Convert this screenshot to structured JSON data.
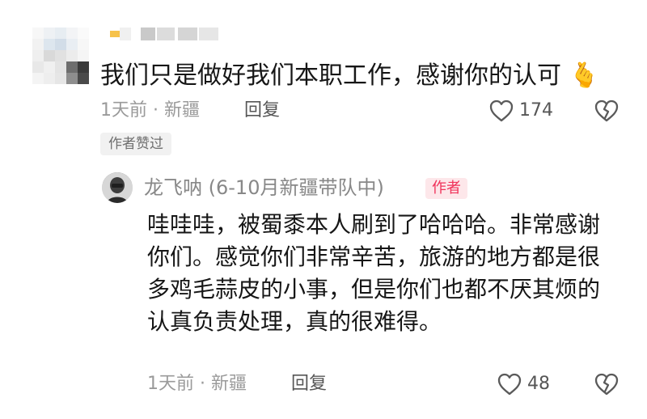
{
  "comment": {
    "text": "我们只是做好我们本职工作，感谢你的认可",
    "emoji": "🫰",
    "meta": "1天前 · 新疆",
    "reply_label": "回复",
    "like_count": "174",
    "author_liked_badge": "作者赞过"
  },
  "reply": {
    "author_name": "龙飞呐 (6-10月新疆带队中)",
    "author_tag": "作者",
    "text": "哇哇哇，被蜀黍本人刷到了哈哈哈。非常感谢你们。感觉你们非常辛苦，旅游的地方都是很多鸡毛蒜皮的小事，但是你们也都不厌其烦的认真负责处理，真的很难得。",
    "meta": "1天前 · 新疆",
    "reply_label": "回复",
    "like_count": "48"
  },
  "icons": {
    "like": "heart-outline-icon",
    "dislike": "broken-heart-icon"
  }
}
